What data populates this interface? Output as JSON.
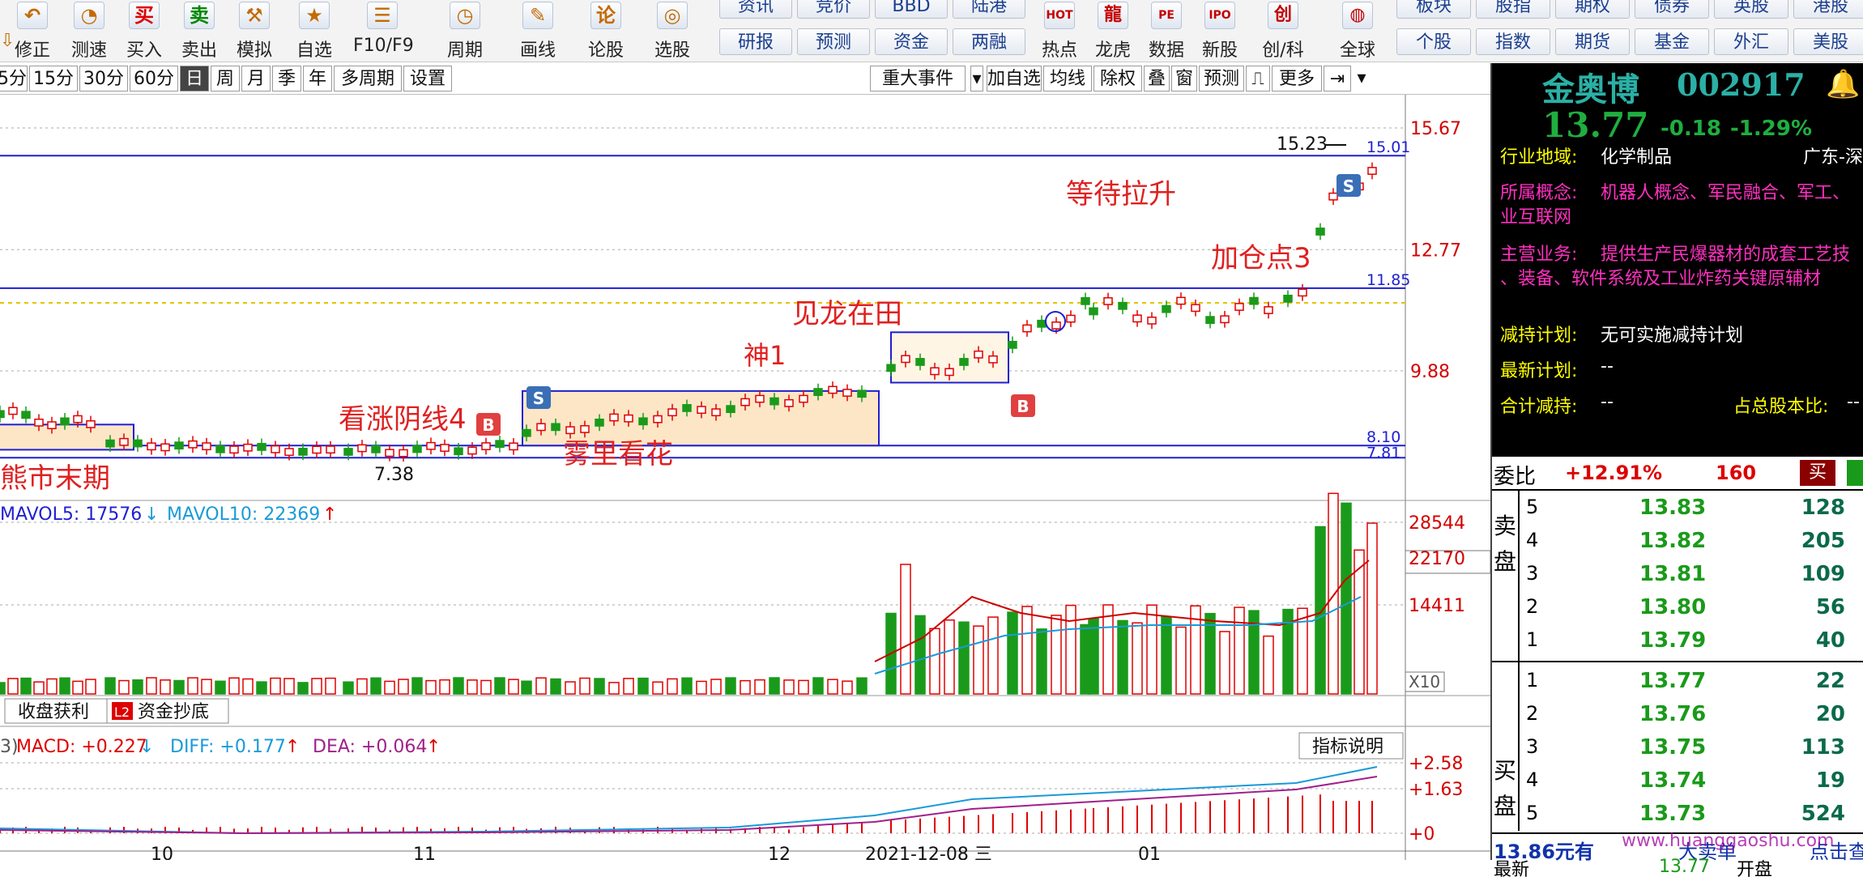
{
  "toolbar": {
    "tools": [
      {
        "icon": "undo-icon",
        "glyph": "↶",
        "label": "修正"
      },
      {
        "icon": "stopwatch-icon",
        "glyph": "◔",
        "label": "测速"
      },
      {
        "icon": "buy-icon",
        "glyph": "买",
        "label": "买入"
      },
      {
        "icon": "sell-icon",
        "glyph": "卖",
        "label": "卖出"
      },
      {
        "icon": "gavel-icon",
        "glyph": "⚒",
        "label": "模拟"
      },
      {
        "icon": "star-icon",
        "glyph": "★",
        "label": "自选"
      },
      {
        "icon": "f10-icon",
        "glyph": "☰",
        "label": "F10/F9"
      },
      {
        "icon": "clock-icon",
        "glyph": "◷",
        "label": "周期"
      },
      {
        "icon": "pen-icon",
        "glyph": "✎",
        "label": "画线"
      },
      {
        "icon": "forum-icon",
        "glyph": "论",
        "label": "论股"
      },
      {
        "icon": "stock-picker-icon",
        "glyph": "◎",
        "label": "选股"
      }
    ],
    "grid_row1": [
      "资讯",
      "竞价",
      "BBD",
      "陆港"
    ],
    "grid_row2": [
      "研报",
      "预测",
      "资金",
      "两融"
    ],
    "tools2": [
      {
        "icon": "hot-icon",
        "glyph": "HOT",
        "label": "热点"
      },
      {
        "icon": "dragon-icon",
        "glyph": "龍",
        "label": "龙虎"
      },
      {
        "icon": "pe-icon",
        "glyph": "PE",
        "label": "数据"
      },
      {
        "icon": "ipo-icon",
        "glyph": "IPO",
        "label": "新股"
      },
      {
        "icon": "chuang-icon",
        "glyph": "创",
        "label": "创/科"
      },
      {
        "icon": "globe-icon",
        "glyph": "◍",
        "label": "全球"
      }
    ],
    "right_row1": [
      "板块",
      "股指",
      "期权",
      "债券",
      "英股",
      "港股"
    ],
    "right_row2": [
      "个股",
      "指数",
      "期货",
      "基金",
      "外汇",
      "美股"
    ]
  },
  "period_bar": {
    "periods": [
      "5分",
      "15分",
      "30分",
      "60分",
      "日",
      "周",
      "月",
      "季",
      "年",
      "多周期",
      "设置"
    ],
    "active": "日",
    "right_buttons": [
      "重大事件",
      "加自选",
      "均线",
      "除权",
      "叠",
      "窗",
      "预测",
      "更多"
    ]
  },
  "chart": {
    "price_labels": [
      "15.67",
      "12.77",
      "9.88"
    ],
    "line_labels": [
      "15.01",
      "11.85",
      "8.10",
      "7.81"
    ],
    "annotations": {
      "high": "15.23",
      "low": "7.38",
      "bear_end": "熊市末期",
      "bullish_yin": "看涨阴线4",
      "fog": "雾里看花",
      "shen1": "神1",
      "dragon": "见龙在田",
      "add_point": "加仓点3",
      "waiting": "等待拉升"
    },
    "markers": {
      "sell": "S",
      "buy": "B"
    },
    "colors": {
      "up": "#e00000",
      "down": "#1a9a1a",
      "line": "#1f1fd0",
      "box_fill": "#fde6c6",
      "gold": "#e6c200"
    }
  },
  "volume": {
    "header": {
      "mavol5_label": "MAVOL5: 17576",
      "mavol5_arrow": "↓",
      "mavol10_label": "MAVOL10: 22369",
      "mavol10_arrow": "↑"
    },
    "axis_labels": [
      "28544",
      "22170",
      "14411"
    ],
    "unit": "X10"
  },
  "tabs": [
    {
      "label": "收盘获利",
      "badge": ""
    },
    {
      "label": "资金抄底",
      "badge": "L2"
    }
  ],
  "macd": {
    "prefix": "3)",
    "macd_label": "MACD: +0.227",
    "macd_arrow": "↓",
    "diff_label": "DIFF: +0.177",
    "diff_arrow": "↑",
    "dea_label": "DEA: +0.064",
    "dea_arrow": "↑",
    "axis_labels": [
      "+2.58",
      "+1.63",
      "+0"
    ],
    "help_button": "指标说明"
  },
  "date_axis": [
    "10",
    "11",
    "12",
    "2021-12-08 三",
    "01"
  ],
  "stock": {
    "name": "金奥博",
    "code": "002917",
    "price": "13.77",
    "change": "-0.18",
    "change_pct": "-1.29%",
    "info": [
      {
        "key": "行业地域:",
        "value": "化学制品",
        "extra": "广东-深"
      },
      {
        "key": "所属概念:",
        "value": "机器人概念、军民融合、军工、",
        "cont": "业互联网"
      },
      {
        "key": "主营业务:",
        "value": "提供生产民爆器材的成套工艺技",
        "cont": "、装备、软件系统及工业炸药关键原辅材"
      },
      {
        "key": "减持计划:",
        "value": "无可实施减持计划"
      },
      {
        "key": "最新计划:",
        "value": "--"
      },
      {
        "key": "合计减持:",
        "value": "--",
        "key2": "占总股本比:",
        "value2": "--"
      }
    ],
    "weibi": {
      "label": "委比",
      "pct": "+12.91%",
      "value": "160",
      "btn": "买"
    },
    "sell_side_label": "卖盘",
    "buy_side_label": "买盘",
    "asks": [
      {
        "level": "5",
        "price": "13.83",
        "vol": "128"
      },
      {
        "level": "4",
        "price": "13.82",
        "vol": "205"
      },
      {
        "level": "3",
        "price": "13.81",
        "vol": "109"
      },
      {
        "level": "2",
        "price": "13.80",
        "vol": "56"
      },
      {
        "level": "1",
        "price": "13.79",
        "vol": "40"
      }
    ],
    "bids": [
      {
        "level": "1",
        "price": "13.77",
        "vol": "22"
      },
      {
        "level": "2",
        "price": "13.76",
        "vol": "20"
      },
      {
        "level": "3",
        "price": "13.75",
        "vol": "113"
      },
      {
        "level": "4",
        "price": "13.74",
        "vol": "19"
      },
      {
        "level": "5",
        "price": "13.73",
        "vol": "524"
      }
    ],
    "bottom_text": "13.86元有",
    "bottom_text2": "大卖单",
    "bottom_text3": "点击查",
    "watermark": "www.huanggaoshu.com",
    "last_row": "最新",
    "last_price": "13.77",
    "open_label": "开盘"
  }
}
